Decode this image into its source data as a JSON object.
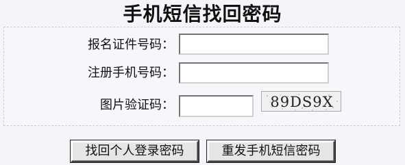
{
  "title": "手机短信找回密码",
  "form": {
    "registration_id": {
      "label": "报名证件号码：",
      "value": ""
    },
    "phone": {
      "label": "注册手机号码：",
      "value": ""
    },
    "captcha": {
      "label": "图片验证码：",
      "value": "",
      "image_text": "89DS9X"
    }
  },
  "buttons": {
    "recover_personal": "找回个人登录密码",
    "resend_sms": "重发手机短信密码"
  }
}
